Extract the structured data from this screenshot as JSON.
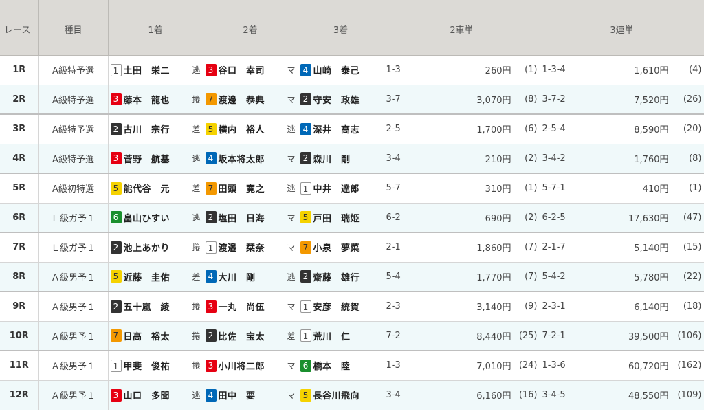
{
  "headers": {
    "race": "レース",
    "class": "種目",
    "first": "1着",
    "second": "2着",
    "third": "3着",
    "exacta": "2車単",
    "trifecta": "3連単"
  },
  "colors": {
    "1": "#ffffff",
    "2": "#333333",
    "3": "#e60012",
    "4": "#0068b7",
    "5": "#f5d200",
    "6": "#1a8f2e",
    "7": "#f39800"
  },
  "rows": [
    {
      "race": "1R",
      "class": "A級特予選",
      "p1": {
        "car": "1",
        "name": "土田　栄二",
        "tactic": "逃"
      },
      "p2": {
        "car": "3",
        "name": "谷口　幸司",
        "tactic": "マ"
      },
      "p3": {
        "car": "4",
        "name": "山崎　泰己",
        "tactic": ""
      },
      "ex": {
        "combo": "1-3",
        "payout": "260円",
        "pop": "(1)"
      },
      "tri": {
        "combo": "1-3-4",
        "payout": "1,610円",
        "pop": "(4)"
      }
    },
    {
      "race": "2R",
      "class": "A級特予選",
      "p1": {
        "car": "3",
        "name": "藤本　龍也",
        "tactic": "捲"
      },
      "p2": {
        "car": "7",
        "name": "渡邊　恭典",
        "tactic": "マ"
      },
      "p3": {
        "car": "2",
        "name": "守安　政雄",
        "tactic": ""
      },
      "ex": {
        "combo": "3-7",
        "payout": "3,070円",
        "pop": "(8)"
      },
      "tri": {
        "combo": "3-7-2",
        "payout": "7,520円",
        "pop": "(26)"
      }
    },
    {
      "race": "3R",
      "class": "A級特予選",
      "p1": {
        "car": "2",
        "name": "古川　宗行",
        "tactic": "差"
      },
      "p2": {
        "car": "5",
        "name": "横内　裕人",
        "tactic": "逃"
      },
      "p3": {
        "car": "4",
        "name": "深井　高志",
        "tactic": ""
      },
      "ex": {
        "combo": "2-5",
        "payout": "1,700円",
        "pop": "(6)"
      },
      "tri": {
        "combo": "2-5-4",
        "payout": "8,590円",
        "pop": "(20)"
      }
    },
    {
      "race": "4R",
      "class": "A級特予選",
      "p1": {
        "car": "3",
        "name": "菅野　航基",
        "tactic": "逃"
      },
      "p2": {
        "car": "4",
        "name": "坂本将太郎",
        "tactic": "マ"
      },
      "p3": {
        "car": "2",
        "name": "森川　剛",
        "tactic": ""
      },
      "ex": {
        "combo": "3-4",
        "payout": "210円",
        "pop": "(2)"
      },
      "tri": {
        "combo": "3-4-2",
        "payout": "1,760円",
        "pop": "(8)"
      }
    },
    {
      "race": "5R",
      "class": "A級初特選",
      "p1": {
        "car": "5",
        "name": "能代谷　元",
        "tactic": "差"
      },
      "p2": {
        "car": "7",
        "name": "田頭　寛之",
        "tactic": "逃"
      },
      "p3": {
        "car": "1",
        "name": "中井　達郎",
        "tactic": ""
      },
      "ex": {
        "combo": "5-7",
        "payout": "310円",
        "pop": "(1)"
      },
      "tri": {
        "combo": "5-7-1",
        "payout": "410円",
        "pop": "(1)"
      }
    },
    {
      "race": "6R",
      "class": "Ｌ級ガ予１",
      "p1": {
        "car": "6",
        "name": "畠山ひすい",
        "tactic": "逃"
      },
      "p2": {
        "car": "2",
        "name": "塩田　日海",
        "tactic": "マ"
      },
      "p3": {
        "car": "5",
        "name": "戸田　瑞姫",
        "tactic": ""
      },
      "ex": {
        "combo": "6-2",
        "payout": "690円",
        "pop": "(2)"
      },
      "tri": {
        "combo": "6-2-5",
        "payout": "17,630円",
        "pop": "(47)"
      }
    },
    {
      "race": "7R",
      "class": "Ｌ級ガ予１",
      "p1": {
        "car": "2",
        "name": "池上あかり",
        "tactic": "捲"
      },
      "p2": {
        "car": "1",
        "name": "渡邉　栞奈",
        "tactic": "マ"
      },
      "p3": {
        "car": "7",
        "name": "小泉　夢菜",
        "tactic": ""
      },
      "ex": {
        "combo": "2-1",
        "payout": "1,860円",
        "pop": "(7)"
      },
      "tri": {
        "combo": "2-1-7",
        "payout": "5,140円",
        "pop": "(15)"
      }
    },
    {
      "race": "8R",
      "class": "Ａ級男予１",
      "p1": {
        "car": "5",
        "name": "近藤　圭佑",
        "tactic": "差"
      },
      "p2": {
        "car": "4",
        "name": "大川　剛",
        "tactic": "逃"
      },
      "p3": {
        "car": "2",
        "name": "齋藤　雄行",
        "tactic": ""
      },
      "ex": {
        "combo": "5-4",
        "payout": "1,770円",
        "pop": "(7)"
      },
      "tri": {
        "combo": "5-4-2",
        "payout": "5,780円",
        "pop": "(22)"
      }
    },
    {
      "race": "9R",
      "class": "Ａ級男予１",
      "p1": {
        "car": "2",
        "name": "五十嵐　綾",
        "tactic": "捲"
      },
      "p2": {
        "car": "3",
        "name": "一丸　尚伍",
        "tactic": "マ"
      },
      "p3": {
        "car": "1",
        "name": "安彦　統賀",
        "tactic": ""
      },
      "ex": {
        "combo": "2-3",
        "payout": "3,140円",
        "pop": "(9)"
      },
      "tri": {
        "combo": "2-3-1",
        "payout": "6,140円",
        "pop": "(18)"
      }
    },
    {
      "race": "10R",
      "class": "Ａ級男予１",
      "p1": {
        "car": "7",
        "name": "日高　裕太",
        "tactic": "捲"
      },
      "p2": {
        "car": "2",
        "name": "比佐　宝太",
        "tactic": "差"
      },
      "p3": {
        "car": "1",
        "name": "荒川　仁",
        "tactic": ""
      },
      "ex": {
        "combo": "7-2",
        "payout": "8,440円",
        "pop": "(25)"
      },
      "tri": {
        "combo": "7-2-1",
        "payout": "39,500円",
        "pop": "(106)"
      }
    },
    {
      "race": "11R",
      "class": "Ａ級男予１",
      "p1": {
        "car": "1",
        "name": "甲斐　俊祐",
        "tactic": "捲"
      },
      "p2": {
        "car": "3",
        "name": "小川将二郎",
        "tactic": "マ"
      },
      "p3": {
        "car": "6",
        "name": "橋本　陸",
        "tactic": ""
      },
      "ex": {
        "combo": "1-3",
        "payout": "7,010円",
        "pop": "(24)"
      },
      "tri": {
        "combo": "1-3-6",
        "payout": "60,720円",
        "pop": "(162)"
      }
    },
    {
      "race": "12R",
      "class": "Ａ級男予１",
      "p1": {
        "car": "3",
        "name": "山口　多聞",
        "tactic": "逃"
      },
      "p2": {
        "car": "4",
        "name": "田中　要",
        "tactic": "マ"
      },
      "p3": {
        "car": "5",
        "name": "長谷川飛向",
        "tactic": ""
      },
      "ex": {
        "combo": "3-4",
        "payout": "6,160円",
        "pop": "(16)"
      },
      "tri": {
        "combo": "3-4-5",
        "payout": "48,550円",
        "pop": "(109)"
      }
    }
  ]
}
